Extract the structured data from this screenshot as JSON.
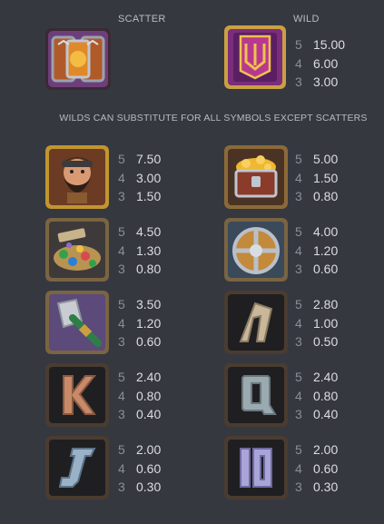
{
  "header": {
    "scatter_label": "SCATTER",
    "wild_label": "WILD",
    "substitute_note": "WILDS CAN SUBSTITUTE FOR ALL SYMBOLS EXCEPT SCATTERS"
  },
  "wild": {
    "icon": "wild-banner-icon",
    "pays": [
      {
        "count": "5",
        "value": "15.00"
      },
      {
        "count": "4",
        "value": "6.00"
      },
      {
        "count": "3",
        "value": "3.00"
      }
    ]
  },
  "scatter": {
    "icon": "scatter-portal-icon"
  },
  "symbols": [
    {
      "icon": "dwarf-icon",
      "pays": [
        {
          "count": "5",
          "value": "7.50"
        },
        {
          "count": "4",
          "value": "3.00"
        },
        {
          "count": "3",
          "value": "1.50"
        }
      ]
    },
    {
      "icon": "gold-chest-icon",
      "pays": [
        {
          "count": "5",
          "value": "5.00"
        },
        {
          "count": "4",
          "value": "1.50"
        },
        {
          "count": "3",
          "value": "0.80"
        }
      ]
    },
    {
      "icon": "gem-treasure-icon",
      "pays": [
        {
          "count": "5",
          "value": "4.50"
        },
        {
          "count": "4",
          "value": "1.30"
        },
        {
          "count": "3",
          "value": "0.80"
        }
      ]
    },
    {
      "icon": "shield-icon",
      "pays": [
        {
          "count": "5",
          "value": "4.00"
        },
        {
          "count": "4",
          "value": "1.20"
        },
        {
          "count": "3",
          "value": "0.60"
        }
      ]
    },
    {
      "icon": "hammer-icon",
      "pays": [
        {
          "count": "5",
          "value": "3.50"
        },
        {
          "count": "4",
          "value": "1.20"
        },
        {
          "count": "3",
          "value": "0.60"
        }
      ]
    },
    {
      "icon": "rune-a-icon",
      "pays": [
        {
          "count": "5",
          "value": "2.80"
        },
        {
          "count": "4",
          "value": "1.00"
        },
        {
          "count": "3",
          "value": "0.50"
        }
      ]
    },
    {
      "icon": "rune-k-icon",
      "pays": [
        {
          "count": "5",
          "value": "2.40"
        },
        {
          "count": "4",
          "value": "0.80"
        },
        {
          "count": "3",
          "value": "0.40"
        }
      ]
    },
    {
      "icon": "rune-q-icon",
      "pays": [
        {
          "count": "5",
          "value": "2.40"
        },
        {
          "count": "4",
          "value": "0.80"
        },
        {
          "count": "3",
          "value": "0.40"
        }
      ]
    },
    {
      "icon": "rune-j-icon",
      "pays": [
        {
          "count": "5",
          "value": "2.00"
        },
        {
          "count": "4",
          "value": "0.60"
        },
        {
          "count": "3",
          "value": "0.30"
        }
      ]
    },
    {
      "icon": "rune-10-icon",
      "pays": [
        {
          "count": "5",
          "value": "2.00"
        },
        {
          "count": "4",
          "value": "0.60"
        },
        {
          "count": "3",
          "value": "0.30"
        }
      ]
    }
  ]
}
